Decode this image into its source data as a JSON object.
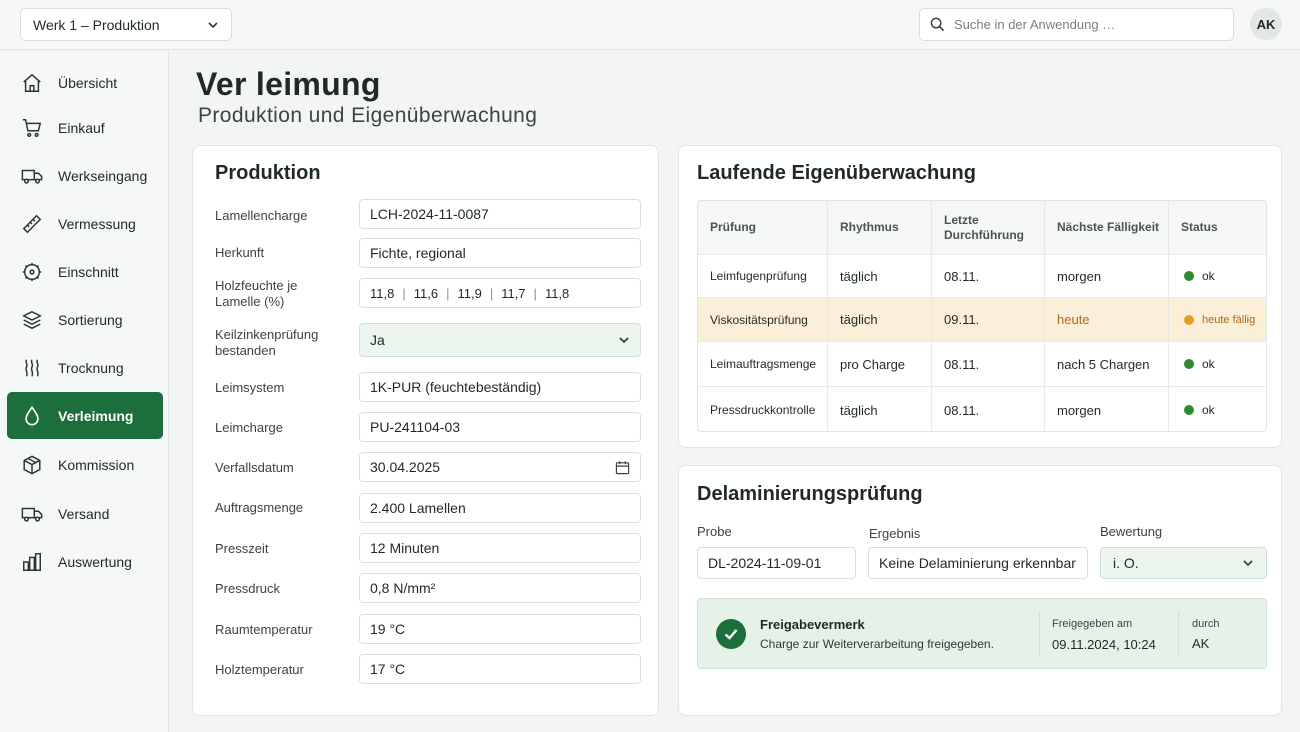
{
  "topbar": {
    "plant_select": "Werk 1 – Produktion",
    "search_placeholder": "Suche in der Anwendung …",
    "user_initials": "AK"
  },
  "sidebar": {
    "items": [
      {
        "label": "Übersicht",
        "icon": "home-icon"
      },
      {
        "label": "Einkauf",
        "icon": "cart-icon"
      },
      {
        "label": "Werkseingang",
        "icon": "truck-icon"
      },
      {
        "label": "Vermessung",
        "icon": "ruler-icon"
      },
      {
        "label": "Einschnitt",
        "icon": "saw-blade-icon"
      },
      {
        "label": "Sortierung",
        "icon": "layers-icon"
      },
      {
        "label": "Trocknung",
        "icon": "heat-waves-icon"
      },
      {
        "label": "Verleimung",
        "icon": "glue-drop-icon",
        "active": true
      },
      {
        "label": "Kommission",
        "icon": "package-icon"
      },
      {
        "label": "Versand",
        "icon": "truck-icon"
      },
      {
        "label": "Auswertung",
        "icon": "bar-chart-icon"
      }
    ]
  },
  "page": {
    "title": "Ver leimung",
    "subtitle": "Produktion und Eigenüberwachung"
  },
  "production": {
    "title": "Produktion",
    "fields": {
      "lamellencharge": {
        "label": "Lamellencharge",
        "value": "LCH-2024-11-0087"
      },
      "herkunft": {
        "label": "Herkunft",
        "value": "Fichte, regional"
      },
      "holzfeuchte": {
        "label": "Holzfeuchte je Lamelle (%)",
        "values": [
          "11,8",
          "11,6",
          "11,9",
          "11,7",
          "11,8"
        ]
      },
      "keilzinken": {
        "label": "Keilzinkenprüfung bestanden",
        "value": "Ja"
      },
      "leimsystem": {
        "label": "Leimsystem",
        "value": "1K-PUR (feuchtebeständig)"
      },
      "leimcharge": {
        "label": "Leimcharge",
        "value": "PU-241104-03"
      },
      "verfallsdatum": {
        "label": "Verfallsdatum",
        "value": "30.04.2025"
      },
      "auftragsmenge": {
        "label": "Auftragsmenge",
        "value": "2.400 Lamellen"
      },
      "presszeit": {
        "label": "Presszeit",
        "value": "12 Minuten"
      },
      "pressdruck": {
        "label": "Pressdruck",
        "value": "0,8 N/mm²"
      },
      "raumtemperatur": {
        "label": "Raumtemperatur",
        "value": "19 °C"
      },
      "holztemperatur": {
        "label": "Holztemperatur",
        "value": "17 °C"
      }
    }
  },
  "monitoring": {
    "title": "Laufende Eigenüberwachung",
    "columns": [
      "Prüfung",
      "Rhythmus",
      "Letzte Durchführung",
      "Nächste Fälligkeit",
      "Status"
    ],
    "rows": [
      {
        "check": "Leimfugenprüfung",
        "rhythm": "täglich",
        "last": "08.11.",
        "next": "morgen",
        "status": "ok",
        "status_color": "#2e8b2e"
      },
      {
        "check": "Viskositätsprüfung",
        "rhythm": "täglich",
        "last": "09.11.",
        "next": "heute",
        "status": "heute fällig",
        "status_color": "#e0a020"
      },
      {
        "check": "Leimauftragsmenge",
        "rhythm": "pro Charge",
        "last": "08.11.",
        "next": "nach 5 Chargen",
        "status": "ok",
        "status_color": "#2e8b2e"
      },
      {
        "check": "Pressdruckkontrolle",
        "rhythm": "täglich",
        "last": "08.11.",
        "next": "morgen",
        "status": "ok",
        "status_color": "#2e8b2e"
      }
    ]
  },
  "delamination": {
    "title": "Delaminierungsprüfung",
    "probe_label": "Probe",
    "probe_value": "DL-2024-11-09-01",
    "ergebnis_label": "Ergebnis",
    "ergebnis_value": "Keine Delaminierung erkennbar",
    "bewertung_label": "Bewertung",
    "bewertung_value": "i. O.",
    "release": {
      "title": "Freigabevermerk",
      "text": "Charge zur Weiterverarbeitung freigegeben.",
      "released_label": "Freigegeben am",
      "released_value": "09.11.2024, 10:24",
      "by_label": "durch",
      "by_value": "AK"
    }
  },
  "colors": {
    "accent": "#1c6e3a",
    "ok": "#2e8b2e",
    "warning": "#e0a020",
    "due_row": "#fbefd9"
  }
}
